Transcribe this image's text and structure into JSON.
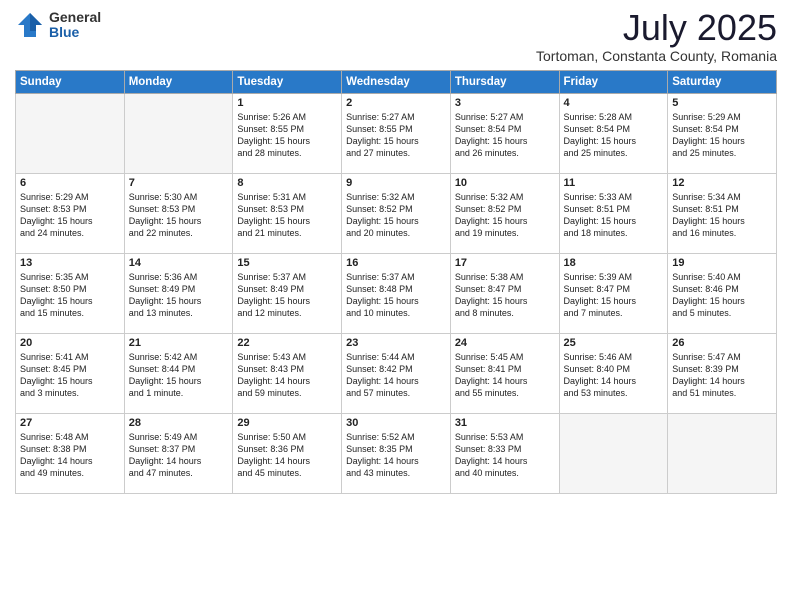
{
  "logo": {
    "general": "General",
    "blue": "Blue"
  },
  "title": "July 2025",
  "location": "Tortoman, Constanta County, Romania",
  "headers": [
    "Sunday",
    "Monday",
    "Tuesday",
    "Wednesday",
    "Thursday",
    "Friday",
    "Saturday"
  ],
  "weeks": [
    [
      {
        "day": "",
        "empty": true,
        "info": ""
      },
      {
        "day": "",
        "empty": true,
        "info": ""
      },
      {
        "day": "1",
        "empty": false,
        "info": "Sunrise: 5:26 AM\nSunset: 8:55 PM\nDaylight: 15 hours\nand 28 minutes."
      },
      {
        "day": "2",
        "empty": false,
        "info": "Sunrise: 5:27 AM\nSunset: 8:55 PM\nDaylight: 15 hours\nand 27 minutes."
      },
      {
        "day": "3",
        "empty": false,
        "info": "Sunrise: 5:27 AM\nSunset: 8:54 PM\nDaylight: 15 hours\nand 26 minutes."
      },
      {
        "day": "4",
        "empty": false,
        "info": "Sunrise: 5:28 AM\nSunset: 8:54 PM\nDaylight: 15 hours\nand 25 minutes."
      },
      {
        "day": "5",
        "empty": false,
        "info": "Sunrise: 5:29 AM\nSunset: 8:54 PM\nDaylight: 15 hours\nand 25 minutes."
      }
    ],
    [
      {
        "day": "6",
        "empty": false,
        "info": "Sunrise: 5:29 AM\nSunset: 8:53 PM\nDaylight: 15 hours\nand 24 minutes."
      },
      {
        "day": "7",
        "empty": false,
        "info": "Sunrise: 5:30 AM\nSunset: 8:53 PM\nDaylight: 15 hours\nand 22 minutes."
      },
      {
        "day": "8",
        "empty": false,
        "info": "Sunrise: 5:31 AM\nSunset: 8:53 PM\nDaylight: 15 hours\nand 21 minutes."
      },
      {
        "day": "9",
        "empty": false,
        "info": "Sunrise: 5:32 AM\nSunset: 8:52 PM\nDaylight: 15 hours\nand 20 minutes."
      },
      {
        "day": "10",
        "empty": false,
        "info": "Sunrise: 5:32 AM\nSunset: 8:52 PM\nDaylight: 15 hours\nand 19 minutes."
      },
      {
        "day": "11",
        "empty": false,
        "info": "Sunrise: 5:33 AM\nSunset: 8:51 PM\nDaylight: 15 hours\nand 18 minutes."
      },
      {
        "day": "12",
        "empty": false,
        "info": "Sunrise: 5:34 AM\nSunset: 8:51 PM\nDaylight: 15 hours\nand 16 minutes."
      }
    ],
    [
      {
        "day": "13",
        "empty": false,
        "info": "Sunrise: 5:35 AM\nSunset: 8:50 PM\nDaylight: 15 hours\nand 15 minutes."
      },
      {
        "day": "14",
        "empty": false,
        "info": "Sunrise: 5:36 AM\nSunset: 8:49 PM\nDaylight: 15 hours\nand 13 minutes."
      },
      {
        "day": "15",
        "empty": false,
        "info": "Sunrise: 5:37 AM\nSunset: 8:49 PM\nDaylight: 15 hours\nand 12 minutes."
      },
      {
        "day": "16",
        "empty": false,
        "info": "Sunrise: 5:37 AM\nSunset: 8:48 PM\nDaylight: 15 hours\nand 10 minutes."
      },
      {
        "day": "17",
        "empty": false,
        "info": "Sunrise: 5:38 AM\nSunset: 8:47 PM\nDaylight: 15 hours\nand 8 minutes."
      },
      {
        "day": "18",
        "empty": false,
        "info": "Sunrise: 5:39 AM\nSunset: 8:47 PM\nDaylight: 15 hours\nand 7 minutes."
      },
      {
        "day": "19",
        "empty": false,
        "info": "Sunrise: 5:40 AM\nSunset: 8:46 PM\nDaylight: 15 hours\nand 5 minutes."
      }
    ],
    [
      {
        "day": "20",
        "empty": false,
        "info": "Sunrise: 5:41 AM\nSunset: 8:45 PM\nDaylight: 15 hours\nand 3 minutes."
      },
      {
        "day": "21",
        "empty": false,
        "info": "Sunrise: 5:42 AM\nSunset: 8:44 PM\nDaylight: 15 hours\nand 1 minute."
      },
      {
        "day": "22",
        "empty": false,
        "info": "Sunrise: 5:43 AM\nSunset: 8:43 PM\nDaylight: 14 hours\nand 59 minutes."
      },
      {
        "day": "23",
        "empty": false,
        "info": "Sunrise: 5:44 AM\nSunset: 8:42 PM\nDaylight: 14 hours\nand 57 minutes."
      },
      {
        "day": "24",
        "empty": false,
        "info": "Sunrise: 5:45 AM\nSunset: 8:41 PM\nDaylight: 14 hours\nand 55 minutes."
      },
      {
        "day": "25",
        "empty": false,
        "info": "Sunrise: 5:46 AM\nSunset: 8:40 PM\nDaylight: 14 hours\nand 53 minutes."
      },
      {
        "day": "26",
        "empty": false,
        "info": "Sunrise: 5:47 AM\nSunset: 8:39 PM\nDaylight: 14 hours\nand 51 minutes."
      }
    ],
    [
      {
        "day": "27",
        "empty": false,
        "info": "Sunrise: 5:48 AM\nSunset: 8:38 PM\nDaylight: 14 hours\nand 49 minutes."
      },
      {
        "day": "28",
        "empty": false,
        "info": "Sunrise: 5:49 AM\nSunset: 8:37 PM\nDaylight: 14 hours\nand 47 minutes."
      },
      {
        "day": "29",
        "empty": false,
        "info": "Sunrise: 5:50 AM\nSunset: 8:36 PM\nDaylight: 14 hours\nand 45 minutes."
      },
      {
        "day": "30",
        "empty": false,
        "info": "Sunrise: 5:52 AM\nSunset: 8:35 PM\nDaylight: 14 hours\nand 43 minutes."
      },
      {
        "day": "31",
        "empty": false,
        "info": "Sunrise: 5:53 AM\nSunset: 8:33 PM\nDaylight: 14 hours\nand 40 minutes."
      },
      {
        "day": "",
        "empty": true,
        "info": ""
      },
      {
        "day": "",
        "empty": true,
        "info": ""
      }
    ]
  ]
}
